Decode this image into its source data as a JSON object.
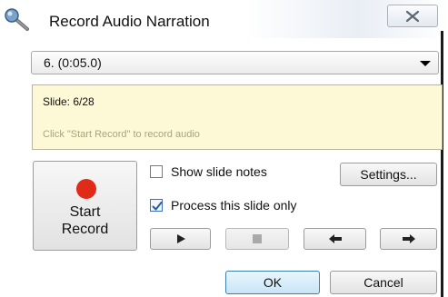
{
  "window": {
    "title": "Record Audio Narration",
    "close_icon": "close-x-icon",
    "app_icon": "microphone-icon"
  },
  "slide_selector": {
    "selected": "6. (0:05.0)"
  },
  "info": {
    "slide": "Slide: 6/28",
    "hint": "Click \"Start Record\" to record audio"
  },
  "record": {
    "label": "Start\nRecord",
    "icon": "record-dot-icon",
    "color": "#e02b18"
  },
  "options": {
    "show_notes_label": "Show slide notes",
    "show_notes_checked": false,
    "process_slide_label": "Process this slide only",
    "process_slide_checked": true
  },
  "buttons": {
    "settings": "Settings...",
    "ok": "OK",
    "cancel": "Cancel"
  },
  "controls": {
    "play_icon": "play-icon",
    "stop_icon": "stop-icon",
    "prev_icon": "arrow-left-icon",
    "next_icon": "arrow-right-icon"
  }
}
